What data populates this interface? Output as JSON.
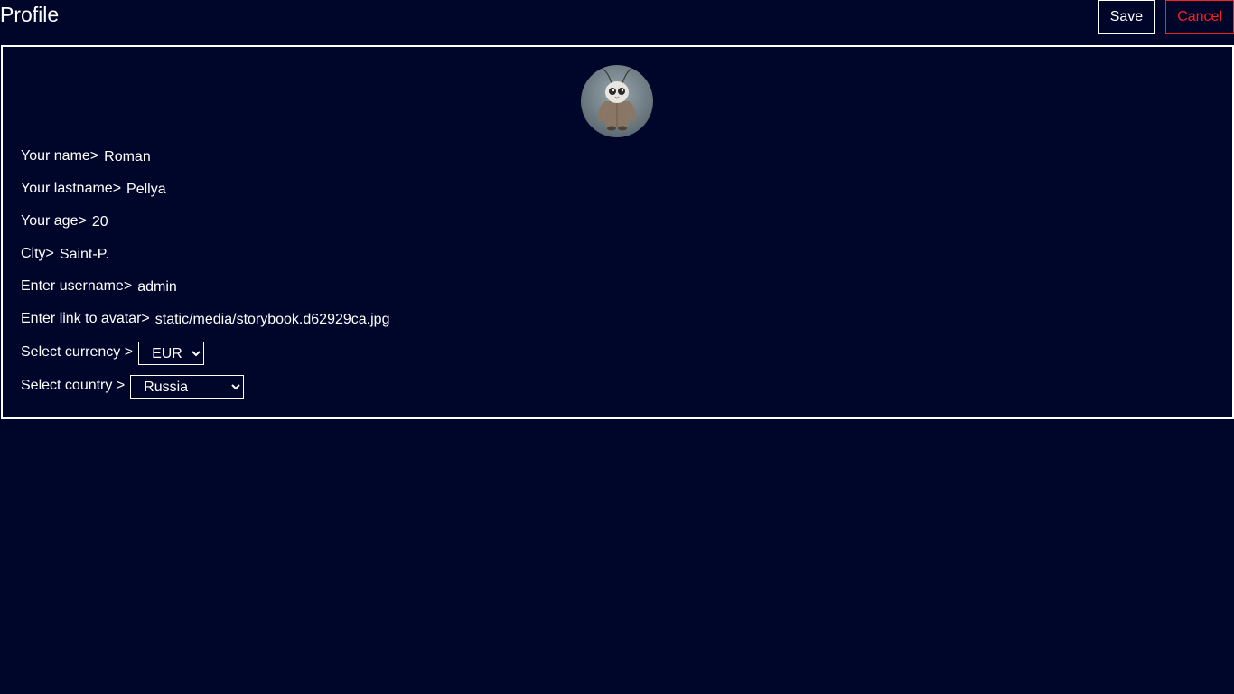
{
  "header": {
    "title": "Profile",
    "save_label": "Save",
    "cancel_label": "Cancel"
  },
  "colors": {
    "background": "#00052a",
    "text": "#ffffff",
    "cancel": "#ff1f1f"
  },
  "form": {
    "avatar_icon": "avatar-image",
    "name": {
      "label": "Your name>",
      "value": "Roman"
    },
    "lastname": {
      "label": "Your lastname>",
      "value": "Pellya"
    },
    "age": {
      "label": "Your age>",
      "value": "20"
    },
    "city": {
      "label": "City>",
      "value": "Saint-P."
    },
    "username": {
      "label": "Enter username>",
      "value": "admin"
    },
    "avatar_link": {
      "label": "Enter link to avatar>",
      "value": "static/media/storybook.d62929ca.jpg"
    },
    "currency": {
      "label": "Select currency >",
      "selected": "EUR"
    },
    "country": {
      "label": "Select country >",
      "selected": "Russia"
    }
  }
}
